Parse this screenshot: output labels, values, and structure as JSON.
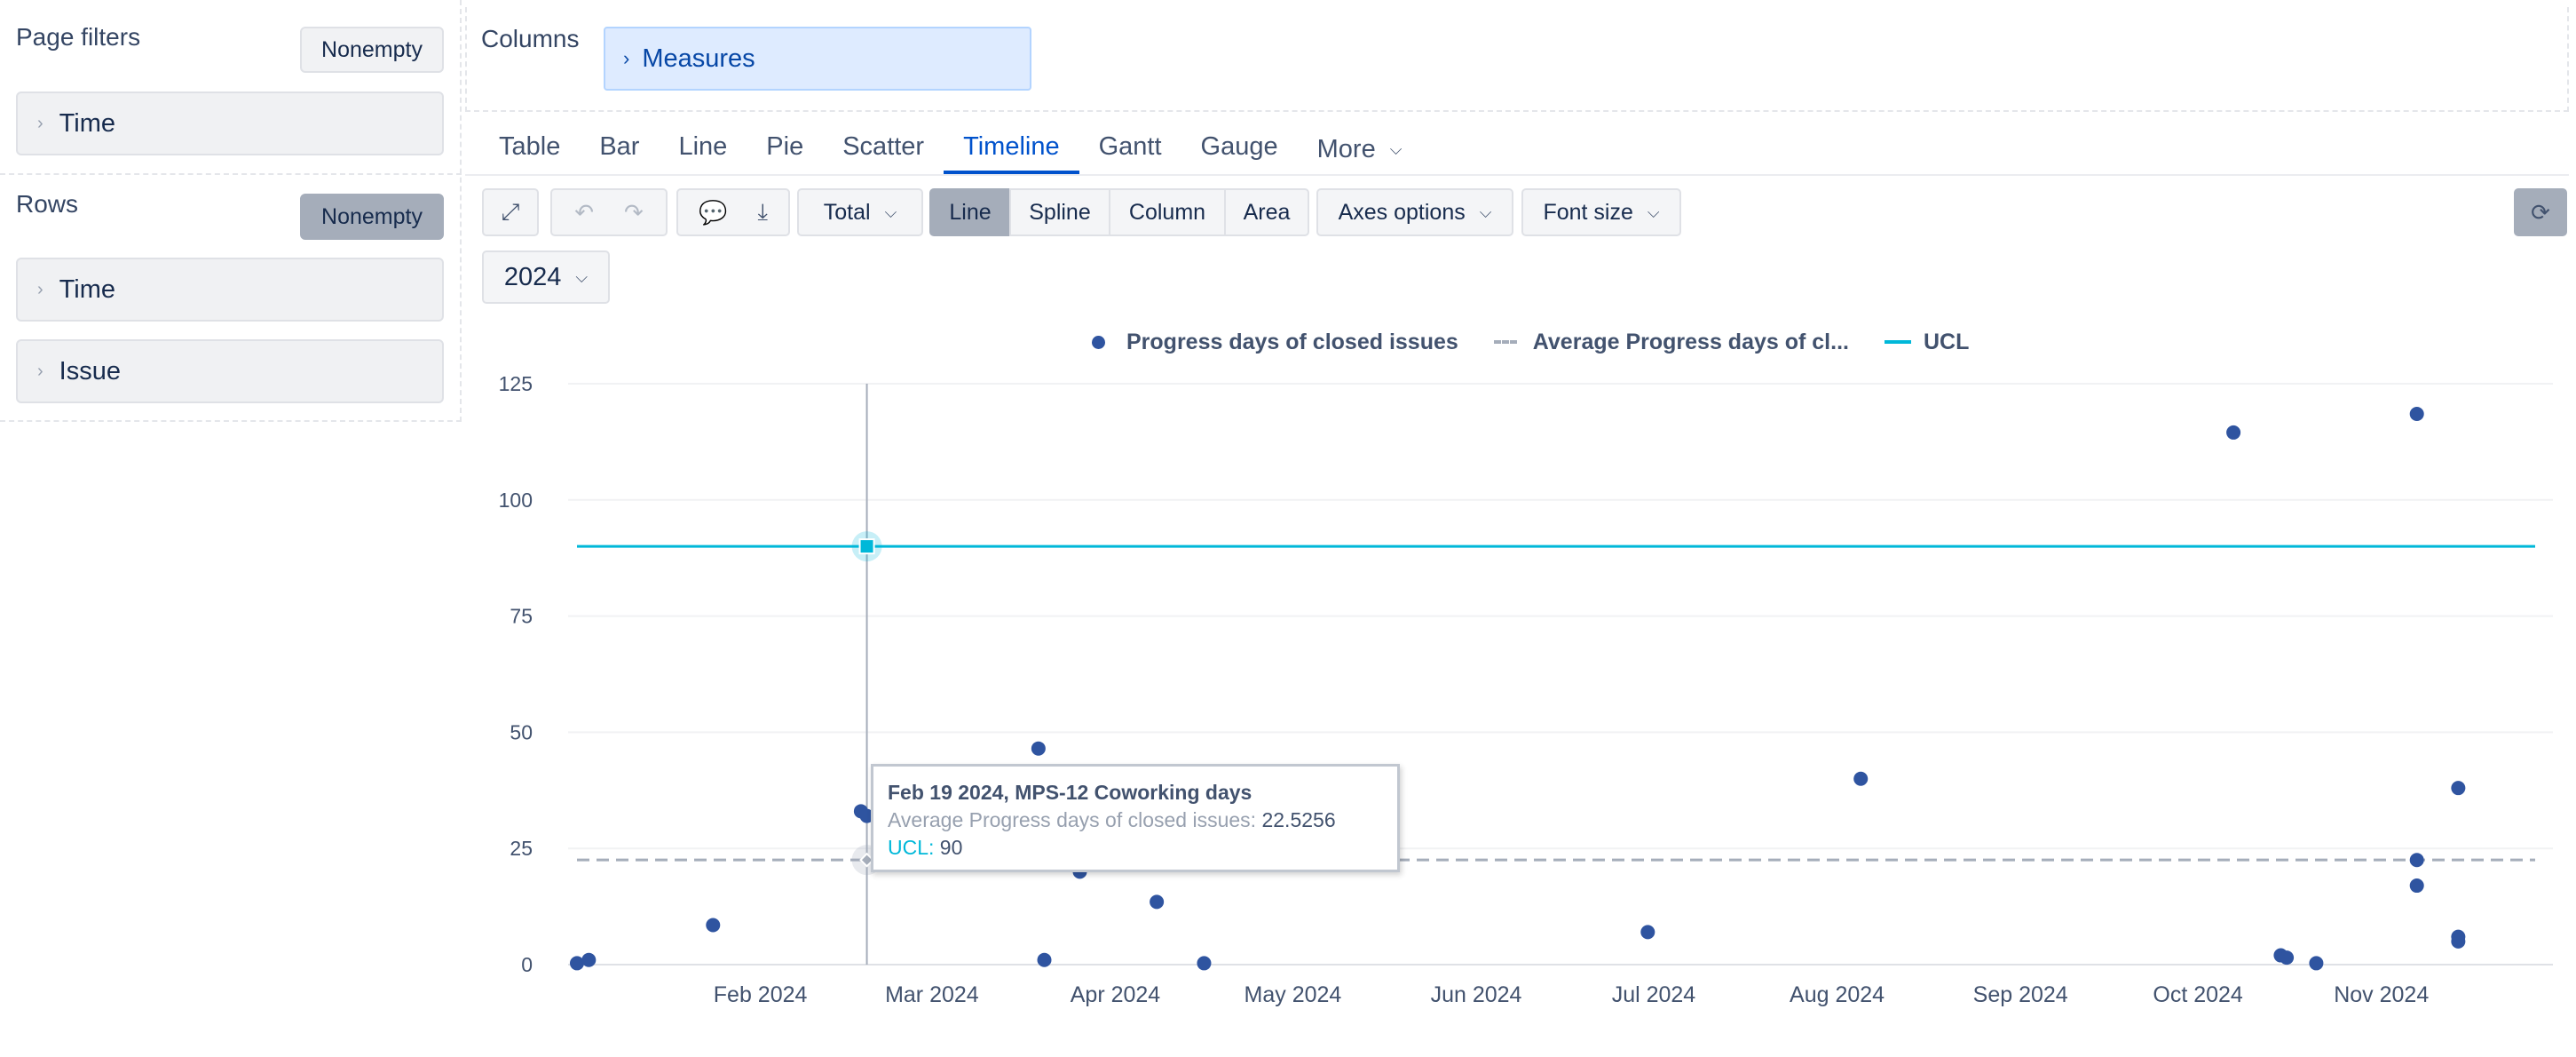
{
  "left": {
    "page_filters": {
      "title": "Page filters",
      "button": "Nonempty",
      "items": [
        "Time"
      ]
    },
    "rows": {
      "title": "Rows",
      "button": "Nonempty",
      "items": [
        "Time",
        "Issue"
      ]
    }
  },
  "columns": {
    "title": "Columns",
    "item": "Measures"
  },
  "tabs": [
    "Table",
    "Bar",
    "Line",
    "Pie",
    "Scatter",
    "Timeline",
    "Gantt",
    "Gauge",
    "More"
  ],
  "active_tab": "Timeline",
  "toolbar": {
    "total": "Total",
    "line": "Line",
    "spline": "Spline",
    "column": "Column",
    "area": "Area",
    "axes_options": "Axes options",
    "font_size": "Font size"
  },
  "year_select": "2024",
  "legend": {
    "series1": "Progress days of closed issues",
    "series2": "Average Progress days of cl...",
    "series3": "UCL"
  },
  "tooltip": {
    "title": "Feb 19 2024, MPS-12 Coworking days",
    "avg_label": "Average Progress days of closed issues:",
    "avg_value": "22.5256",
    "ucl_label": "UCL:",
    "ucl_value": "90"
  },
  "colors": {
    "points": "#2f54a0",
    "ucl": "#00b8d9",
    "average": "#a5adba",
    "accent": "#0052cc"
  },
  "chart_data": {
    "type": "scatter",
    "ylim": [
      0,
      125
    ],
    "yticks": [
      0,
      25,
      50,
      75,
      100,
      125
    ],
    "xlim": [
      "2024-01-01",
      "2024-11-27"
    ],
    "xticks": [
      {
        "label": "Feb 2024",
        "date": "2024-02-01"
      },
      {
        "label": "Mar 2024",
        "date": "2024-03-01"
      },
      {
        "label": "Apr 2024",
        "date": "2024-04-01"
      },
      {
        "label": "May 2024",
        "date": "2024-05-01"
      },
      {
        "label": "Jun 2024",
        "date": "2024-06-01"
      },
      {
        "label": "Jul 2024",
        "date": "2024-07-01"
      },
      {
        "label": "Aug 2024",
        "date": "2024-08-01"
      },
      {
        "label": "Sep 2024",
        "date": "2024-09-01"
      },
      {
        "label": "Oct 2024",
        "date": "2024-10-01"
      },
      {
        "label": "Nov 2024",
        "date": "2024-11-01"
      }
    ],
    "series": [
      {
        "name": "Progress days of closed issues",
        "type": "scatter",
        "points": [
          {
            "x": "2024-01-01",
            "y": 0.3
          },
          {
            "x": "2024-01-03",
            "y": 1
          },
          {
            "x": "2024-01-24",
            "y": 8.5
          },
          {
            "x": "2024-02-18",
            "y": 33
          },
          {
            "x": "2024-02-19",
            "y": 32
          },
          {
            "x": "2024-03-19",
            "y": 46.5
          },
          {
            "x": "2024-03-20",
            "y": 1
          },
          {
            "x": "2024-03-26",
            "y": 20
          },
          {
            "x": "2024-04-08",
            "y": 13.5
          },
          {
            "x": "2024-04-16",
            "y": 0.3
          },
          {
            "x": "2024-06-30",
            "y": 7
          },
          {
            "x": "2024-08-05",
            "y": 40
          },
          {
            "x": "2024-10-07",
            "y": 114.5
          },
          {
            "x": "2024-10-15",
            "y": 2
          },
          {
            "x": "2024-10-16",
            "y": 1.5
          },
          {
            "x": "2024-10-21",
            "y": 0.3
          },
          {
            "x": "2024-11-07",
            "y": 118.5
          },
          {
            "x": "2024-11-07",
            "y": 22.5
          },
          {
            "x": "2024-11-07",
            "y": 17
          },
          {
            "x": "2024-11-14",
            "y": 6
          },
          {
            "x": "2024-11-14",
            "y": 5
          },
          {
            "x": "2024-11-14",
            "y": 38
          }
        ]
      },
      {
        "name": "Average Progress days of closed issues",
        "type": "line",
        "style": "dashed",
        "y": 22.5256
      },
      {
        "name": "UCL",
        "type": "line",
        "y": 90
      }
    ],
    "crosshair_x": "2024-02-19"
  }
}
